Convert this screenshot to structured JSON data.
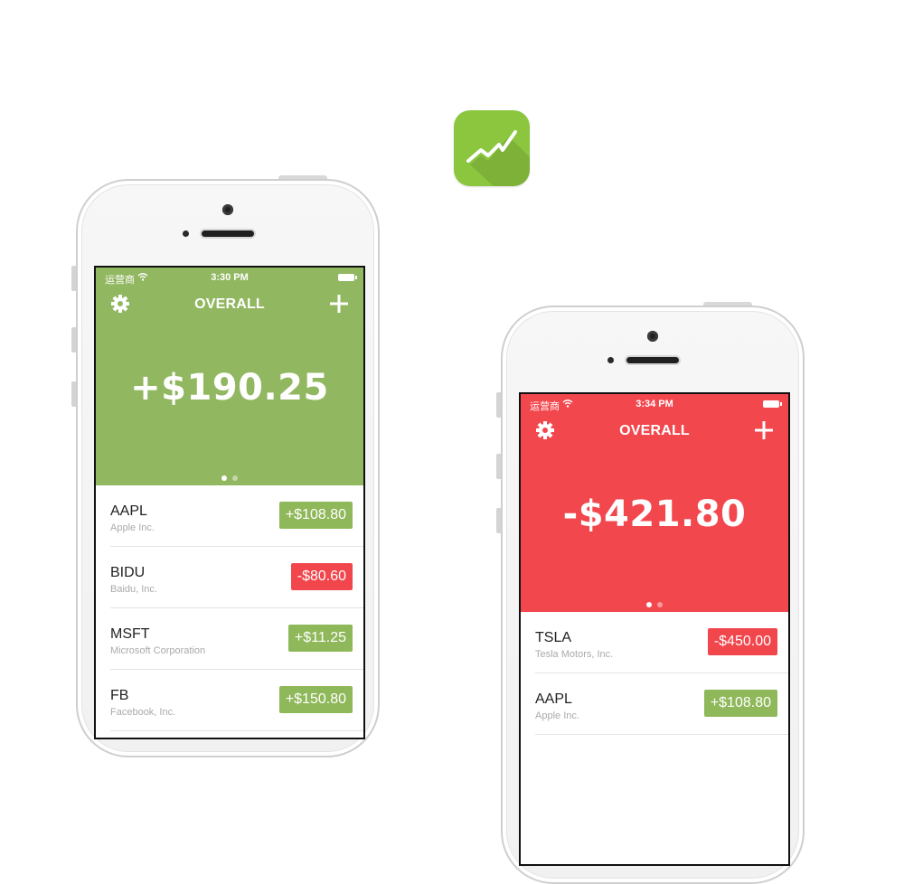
{
  "app_icon": {
    "icon": "trend-up-icon",
    "color": "#8cc63f"
  },
  "phones": [
    {
      "theme_color": "#92b761",
      "status": {
        "carrier": "运营商",
        "time": "3:30 PM"
      },
      "nav": {
        "title": "OVERALL",
        "left_icon": "gear-icon",
        "right_icon": "plus-icon"
      },
      "total": "+$190.25",
      "page_indicator": {
        "count": 2,
        "active": 1
      },
      "stocks": [
        {
          "ticker": "AAPL",
          "company": "Apple Inc.",
          "change": "+$108.80",
          "direction": "up"
        },
        {
          "ticker": "BIDU",
          "company": "Baidu, Inc.",
          "change": "-$80.60",
          "direction": "down"
        },
        {
          "ticker": "MSFT",
          "company": "Microsoft Corporation",
          "change": "+$11.25",
          "direction": "up"
        },
        {
          "ticker": "FB",
          "company": "Facebook, Inc.",
          "change": "+$150.80",
          "direction": "up"
        }
      ]
    },
    {
      "theme_color": "#f3474e",
      "status": {
        "carrier": "运营商",
        "time": "3:34 PM"
      },
      "nav": {
        "title": "OVERALL",
        "left_icon": "gear-icon",
        "right_icon": "plus-icon"
      },
      "total": "-$421.80",
      "page_indicator": {
        "count": 2,
        "active": 1
      },
      "stocks": [
        {
          "ticker": "TSLA",
          "company": "Tesla Motors, Inc.",
          "change": "-$450.00",
          "direction": "down"
        },
        {
          "ticker": "AAPL",
          "company": "Apple Inc.",
          "change": "+$108.80",
          "direction": "up"
        }
      ]
    }
  ]
}
